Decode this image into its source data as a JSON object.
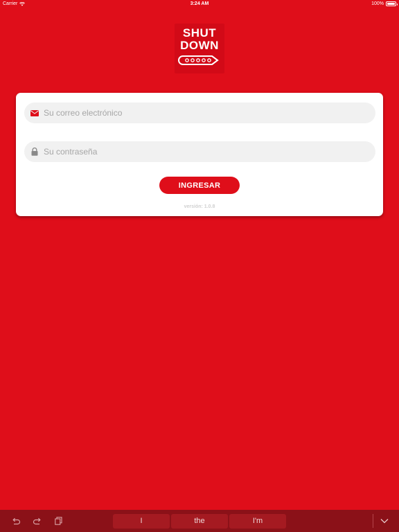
{
  "status_bar": {
    "carrier": "Carrier",
    "time": "3:24 AM",
    "battery": "100%"
  },
  "logo": {
    "line1": "SHUT",
    "line2": "DOWN"
  },
  "login": {
    "email_placeholder": "Su correo electrónico",
    "password_placeholder": "Su contraseña",
    "submit_label": "INGRESAR",
    "version": "versión: 1.0.8"
  },
  "keyboard_bar": {
    "suggestions": [
      "I",
      "the",
      "I'm"
    ]
  },
  "colors": {
    "brand_red": "#DF0E1A",
    "card": "#FFFFFF",
    "field_bg": "#F1F1F1",
    "keyboard_bar": "#8B1118"
  },
  "icons": {
    "email": "envelope-icon",
    "password": "lock-icon",
    "undo": "undo-icon",
    "redo": "redo-icon",
    "paste": "paste-icon",
    "dismiss": "chevron-down-icon"
  }
}
